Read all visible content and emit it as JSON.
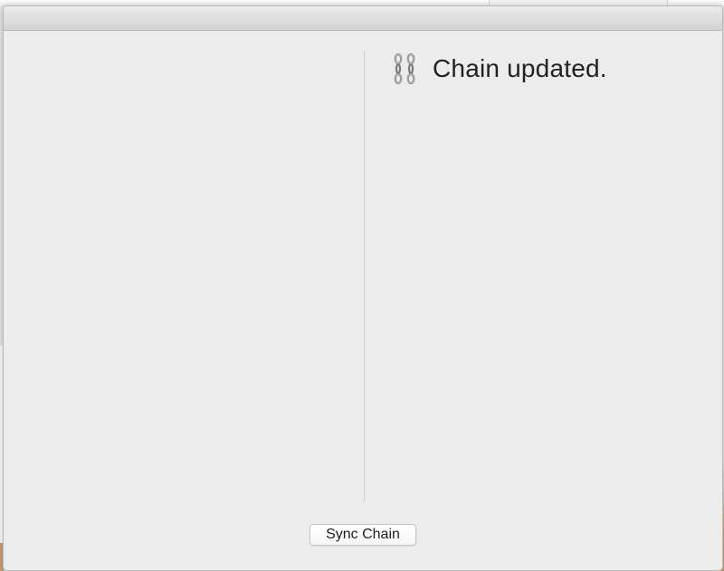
{
  "status": {
    "icon": "chain-link-icon",
    "message": "Chain updated."
  },
  "actions": {
    "sync_label": "Sync Chain"
  },
  "colors": {
    "window_background": "#ececec",
    "divider": "#cfcfcf",
    "text": "#222222"
  }
}
